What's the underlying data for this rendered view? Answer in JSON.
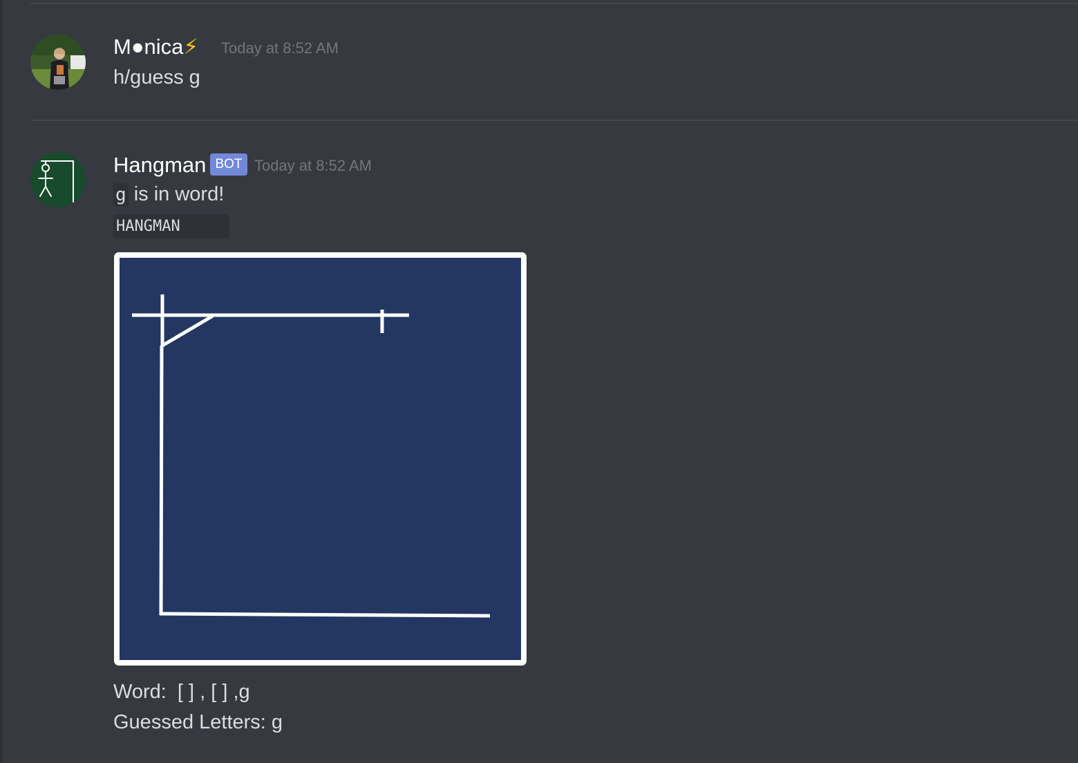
{
  "messages": [
    {
      "author": "M●nica",
      "author_emoji": "⚡",
      "timestamp": "Today at 8:52 AM",
      "content": "h/guess g"
    },
    {
      "author": "Hangman",
      "badge": "BOT",
      "timestamp": "Today at 8:52 AM",
      "inline_code": "g",
      "content_rest": " is in word!",
      "code_block": "HANGMAN",
      "word_line": "Word:  [ ] , [ ] ,g",
      "guessed_line": "Guessed Letters: g"
    }
  ],
  "colors": {
    "background": "#36393f",
    "board_background": "#243762",
    "board_lines": "#ffffff",
    "bot_badge": "#7289da",
    "timestamp": "#72767d",
    "text": "#dcddde"
  }
}
